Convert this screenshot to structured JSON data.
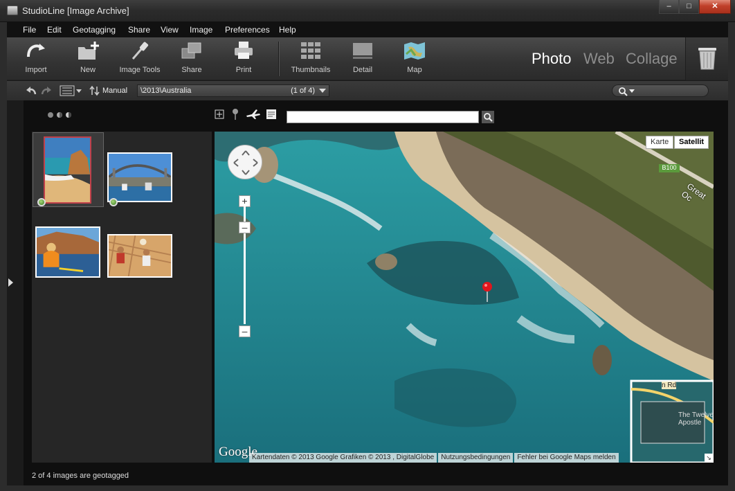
{
  "window": {
    "title": "StudioLine [Image Archive]"
  },
  "menu": [
    "File",
    "Edit",
    "Geotagging",
    "Share",
    "View",
    "Image",
    "Preferences",
    "Help"
  ],
  "toolbar": {
    "tools": [
      {
        "label": "Import",
        "icon": "import-icon"
      },
      {
        "label": "New",
        "icon": "new-folder-icon"
      },
      {
        "label": "Image Tools",
        "icon": "image-tools-icon"
      },
      {
        "label": "Share",
        "icon": "share-icon"
      },
      {
        "label": "Print",
        "icon": "print-icon"
      },
      {
        "label": "Thumbnails",
        "icon": "thumbnails-icon"
      },
      {
        "label": "Detail",
        "icon": "detail-icon"
      },
      {
        "label": "Map",
        "icon": "map-icon"
      }
    ],
    "modes": [
      "Photo",
      "Web",
      "Collage"
    ],
    "active_mode": "Photo"
  },
  "navbar": {
    "sort_label": "Manual",
    "path": "\\2013\\Australia",
    "count": "(1 of 4)"
  },
  "thumbnails": [
    {
      "name": "twelve-apostles-beach",
      "geotagged": true,
      "selected": true
    },
    {
      "name": "sydney-harbour-bridge",
      "geotagged": true,
      "selected": false
    },
    {
      "name": "kayaker-cliffs",
      "geotagged": false,
      "selected": false
    },
    {
      "name": "beach-volleyball",
      "geotagged": false,
      "selected": false
    }
  ],
  "map": {
    "type_buttons": [
      "Karte",
      "Satellit"
    ],
    "active_type": "Satellit",
    "search_value": "",
    "labels": {
      "road": "B100",
      "road_name": "Great Oc",
      "inset_road": "n Rd",
      "inset_place": "The Twelve Apostle"
    },
    "logo": "Google",
    "attribution": [
      "Kartendaten © 2013 Google Grafiken © 2013 , DigitalGlobe",
      "Nutzungsbedingungen",
      "Fehler bei Google Maps melden"
    ]
  },
  "status": "2 of 4 images are geotagged",
  "colors": {
    "accent_red": "#c0402a",
    "geotag_green": "#3c7a23",
    "water": "#1f7c86"
  }
}
